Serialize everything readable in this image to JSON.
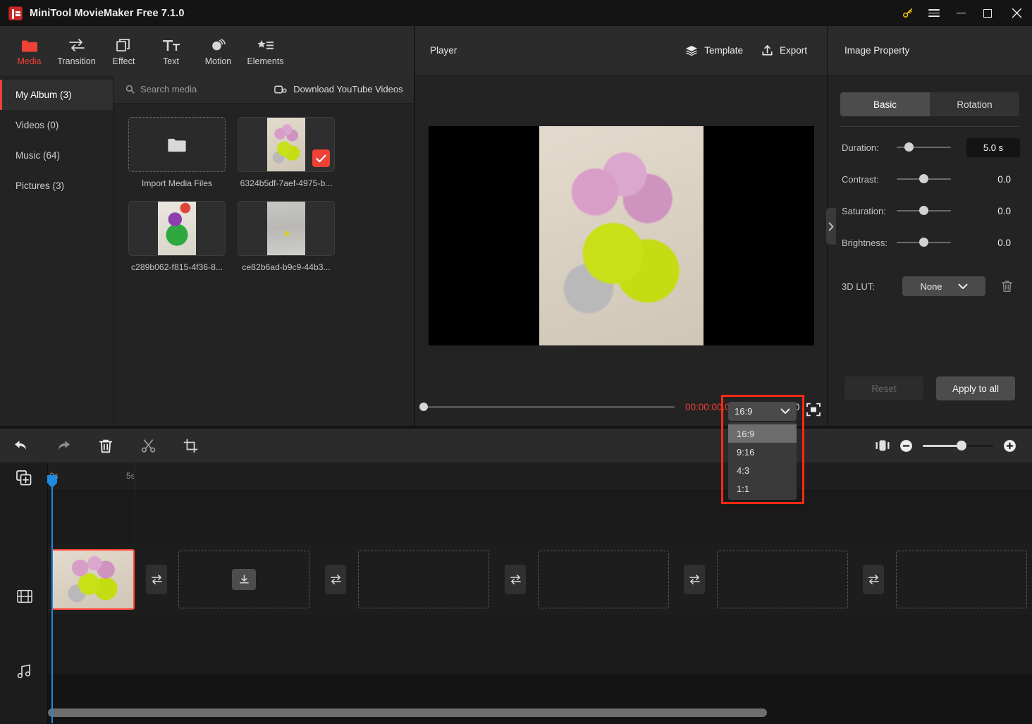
{
  "window": {
    "title": "MiniTool MovieMaker Free 7.1.0",
    "buttons": {
      "key": "key-icon",
      "menu": "hamburger-icon",
      "minimize": "minimize-icon",
      "maximize": "maximize-icon",
      "close": "close-icon"
    }
  },
  "ribbon": {
    "items": [
      {
        "label": "Media",
        "icon": "folder-icon",
        "active": true
      },
      {
        "label": "Transition",
        "icon": "transition-icon",
        "active": false
      },
      {
        "label": "Effect",
        "icon": "effect-icon",
        "active": false
      },
      {
        "label": "Text",
        "icon": "text-icon",
        "active": false
      },
      {
        "label": "Motion",
        "icon": "motion-icon",
        "active": false
      },
      {
        "label": "Elements",
        "icon": "elements-icon",
        "active": false
      }
    ]
  },
  "library": {
    "nav": [
      {
        "label": "My Album (3)",
        "active": true
      },
      {
        "label": "Videos (0)",
        "active": false
      },
      {
        "label": "Music (64)",
        "active": false
      },
      {
        "label": "Pictures (3)",
        "active": false
      }
    ],
    "search_placeholder": "Search media",
    "youtube_label": "Download YouTube Videos",
    "import_label": "Import Media Files",
    "items": [
      {
        "name": "6324b5df-7aef-4975-b...",
        "selected": true,
        "photo": "ph-flowers"
      },
      {
        "name": "c289b062-f815-4f36-8...",
        "selected": false,
        "photo": "ph-lego"
      },
      {
        "name": "ce82b6ad-b9c9-44b3...",
        "selected": false,
        "photo": "ph-couch"
      }
    ]
  },
  "player": {
    "title": "Player",
    "template_label": "Template",
    "export_label": "Export",
    "current_time": "00:00:00.00",
    "separator": "/",
    "total_time": "00:00:05.00",
    "aspect": {
      "selected": "16:9",
      "options": [
        "16:9",
        "9:16",
        "4:3",
        "1:1"
      ],
      "highlight_color": "#ff2a12"
    },
    "transport": [
      "play-icon",
      "previous-frame-icon",
      "next-frame-icon",
      "stop-icon",
      "volume-icon"
    ],
    "fullscreen": "fullscreen-icon"
  },
  "property": {
    "title": "Image Property",
    "tabs": [
      {
        "label": "Basic",
        "active": true
      },
      {
        "label": "Rotation",
        "active": false
      }
    ],
    "rows": [
      {
        "label": "Duration:",
        "value": "5.0 s",
        "knob": 22,
        "boxed": true
      },
      {
        "label": "Contrast:",
        "value": "0.0",
        "knob": 50,
        "boxed": false
      },
      {
        "label": "Saturation:",
        "value": "0.0",
        "knob": 50,
        "boxed": false
      },
      {
        "label": "Brightness:",
        "value": "0.0",
        "knob": 50,
        "boxed": false
      }
    ],
    "lut": {
      "label": "3D LUT:",
      "value": "None"
    },
    "reset_label": "Reset",
    "apply_label": "Apply to all"
  },
  "timeline": {
    "tools": [
      "undo-icon",
      "redo-icon",
      "delete-icon",
      "split-icon",
      "crop-icon"
    ],
    "zoom": {
      "fit_icon": "fit-timeline-icon",
      "minus": "zoom-out-icon",
      "plus": "zoom-in-icon"
    },
    "ruler_ticks": [
      "0s",
      "5s"
    ],
    "tracks": [
      {
        "icon": "video-track-icon"
      },
      {
        "icon": "audio-track-icon"
      }
    ]
  },
  "colors": {
    "accent_red": "#ef4136",
    "highlight_red": "#ff2a12",
    "playhead_blue": "#1e8ae0",
    "panel_bg": "#232323",
    "toolbar_bg": "#2b2b2b",
    "timeline_bg": "#141414"
  }
}
